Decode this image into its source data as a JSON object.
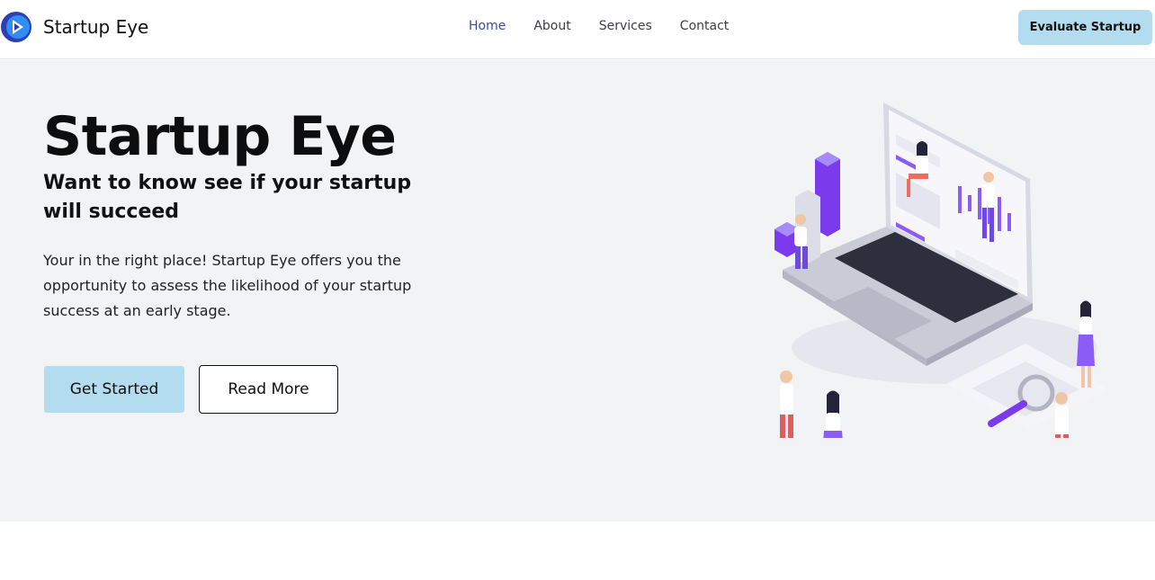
{
  "brand": {
    "name": "Startup Eye",
    "logo_icon": "play-circle-icon",
    "colors": {
      "logo_dark": "#2b3fb5",
      "logo_light": "#2f8ef5"
    }
  },
  "nav": {
    "items": [
      {
        "label": "Home",
        "active": true
      },
      {
        "label": "About",
        "active": false
      },
      {
        "label": "Services",
        "active": false
      },
      {
        "label": "Contact",
        "active": false
      }
    ],
    "cta_label": "Evaluate Startup"
  },
  "hero": {
    "title": "Startup Eye",
    "subtitle": "Want to know see if your startup will succeed",
    "description": "Your in the right place! Startup Eye offers you the opportunity to assess the likelihood of your startup success at an early stage.",
    "primary_button": "Get Started",
    "secondary_button": "Read More",
    "illustration_icon": "laptop-analytics-illustration"
  },
  "colors": {
    "accent_button": "#b3dcee",
    "hero_background": "#f2f3f5",
    "nav_active": "#3b4ba8",
    "purple": "#7c3aed"
  }
}
